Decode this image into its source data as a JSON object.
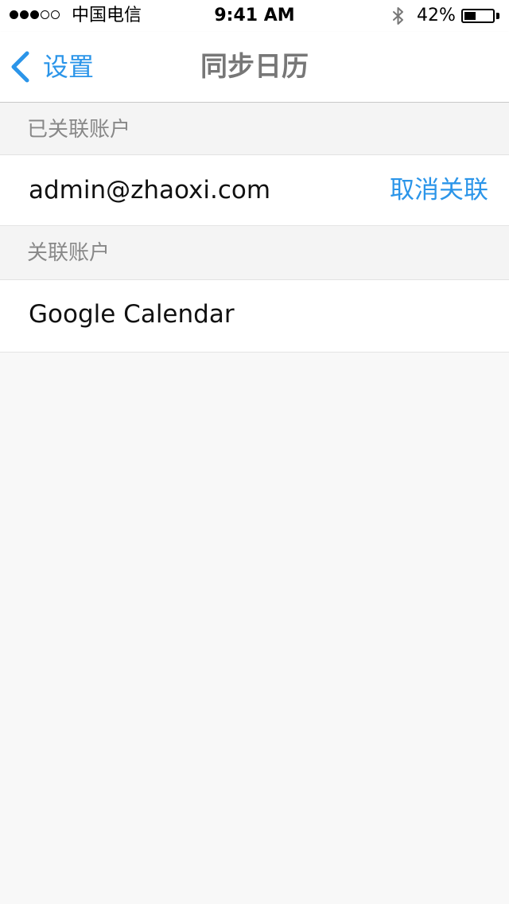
{
  "status_bar": {
    "carrier": "中国电信",
    "time": "9:41 AM",
    "battery_percent": "42%",
    "battery_level": 0.42,
    "signal_bars": 3,
    "signal_total": 5,
    "bluetooth_icon": "bluetooth-icon"
  },
  "nav": {
    "back_label": "设置",
    "back_icon": "chevron-left-icon",
    "title": "同步日历"
  },
  "sections": {
    "linked_header": "已关联账户",
    "linked_account": {
      "email": "admin@zhaoxi.com",
      "action": "取消关联"
    },
    "available_header": "关联账户",
    "available_accounts": [
      {
        "name": "Google Calendar"
      }
    ]
  },
  "colors": {
    "accent": "#2b95e9",
    "background": "#f8f8f8",
    "section_header_text": "#888888",
    "title_text": "#777777"
  }
}
